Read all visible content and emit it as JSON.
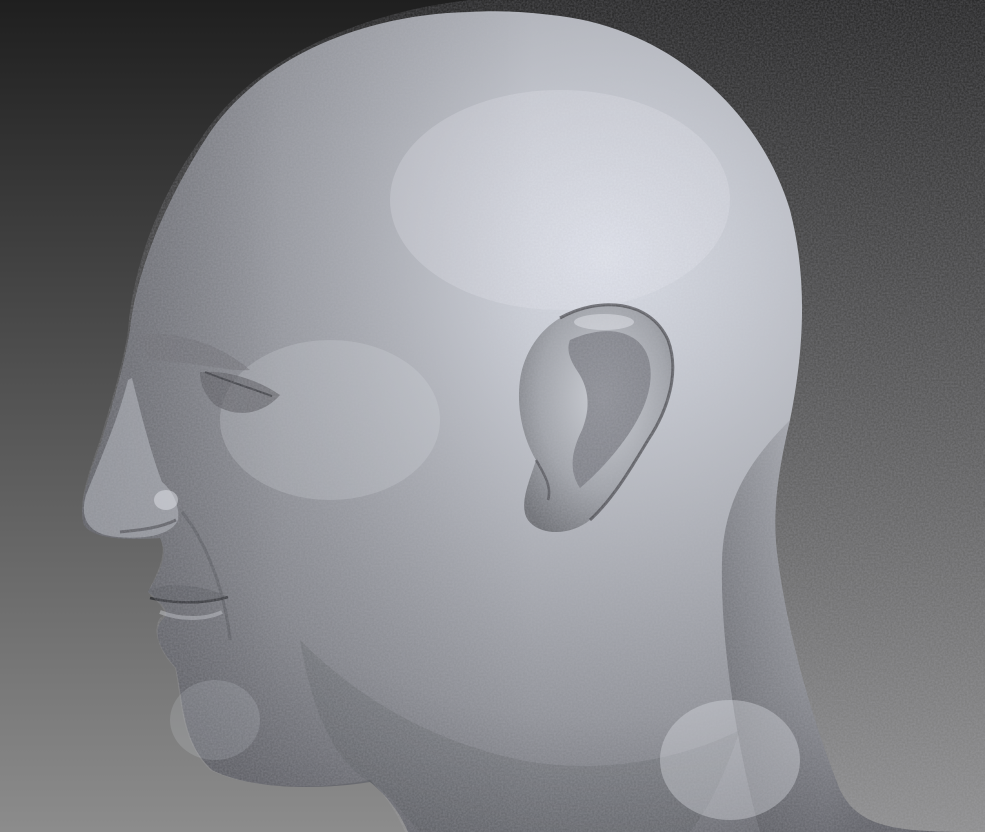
{
  "viewport": {
    "background_top_color": "#1f1f1f",
    "background_bottom_color": "#8c8c8c"
  },
  "sculpt": {
    "subject": "bald-male-head-profile-left",
    "material_color": "#a9abb0",
    "highlight_color": "#dde1ea",
    "shadow_color": "#4b4c50"
  }
}
